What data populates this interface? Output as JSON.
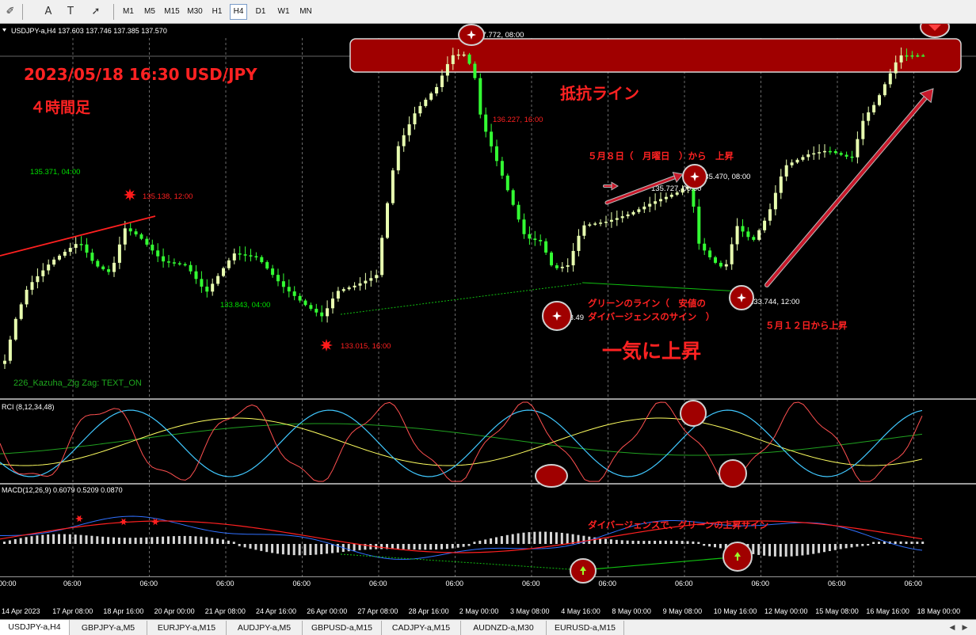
{
  "toolbar": {
    "icons": [
      "pen-tool-icon",
      "label-text-icon",
      "text-frame-icon",
      "arrows-icon"
    ],
    "icon_glyphs": [
      "✐",
      "A",
      "T",
      "➚"
    ],
    "timeframes": [
      "M1",
      "M5",
      "M15",
      "M30",
      "H1",
      "H4",
      "D1",
      "W1",
      "MN"
    ],
    "active_timeframe": "H4"
  },
  "chart": {
    "header": "USDJPY-a,H4  137.603 137.746 137.385 137.570",
    "price_labels": [
      {
        "text": "137.772, 08:00",
        "color": "#ffffff"
      },
      {
        "text": "136.227, 16:00",
        "color": "#ff2020"
      },
      {
        "text": "135.470, 08:00",
        "color": "#ffffff"
      },
      {
        "text": "135.727, 00:00",
        "color": "#ffffff"
      },
      {
        "text": "135.371, 04:00",
        "color": "#00e000"
      },
      {
        "text": "135.138, 12:00",
        "color": "#ff2020"
      },
      {
        "text": "133.843, 04:00",
        "color": "#00e000"
      },
      {
        "text": "133.015, 16:00",
        "color": "#ff2020"
      },
      {
        "text": "133.49",
        "color": "#ffffff"
      },
      {
        "text": "133.744, 12:00",
        "color": "#ffffff"
      }
    ],
    "indicator_label": "226_Kazuha_Zig Zag: TEXT_ON",
    "rci_label": "RCI (8,12,34,48)",
    "macd_label": "MACD(12,26,9) 0.6079 0.5209 0.0870",
    "x_axis_times": [
      "06:00",
      "06:00",
      "06:00",
      "06:00",
      "06:00",
      "06:00",
      "06:00",
      "06:00",
      "06:00",
      "06:00",
      "06:00",
      "06:00",
      "06:00"
    ],
    "x_axis_dates": [
      "14 Apr 2023",
      "17 Apr 08:00",
      "18 Apr 16:00",
      "20 Apr 00:00",
      "21 Apr 08:00",
      "24 Apr 16:00",
      "26 Apr 00:00",
      "27 Apr 08:00",
      "28 Apr 16:00",
      "2 May 00:00",
      "3 May 08:00",
      "4 May 16:00",
      "8 May 00:00",
      "9 May 08:00",
      "10 May 16:00",
      "12 May 00:00",
      "15 May 08:00",
      "16 May 16:00",
      "18 May 00:00"
    ]
  },
  "annotations": {
    "title": "2023/05/18 16:30  USD/JPY",
    "subtitle": "４時間足",
    "resistance": "抵抗ライン",
    "may8": "５月８日（　月曜日　）から　上昇",
    "green_line_1": "グリーンのライン（　安値の",
    "green_line_2": "ダイバージェンスのサイン　）",
    "may12": "５月１２日から上昇",
    "surge": "一気に上昇",
    "macd_note": "ダイバージェンスで、グリーンの上昇サイン"
  },
  "colors": {
    "bull_candle": "#e8ffb0",
    "bear_candle": "#33ff33",
    "annotation_red": "#ff2222",
    "resistance_fill": "#a00000",
    "rci_fast": "#ff5050",
    "rci_mid": "#40c8ff",
    "rci_slow": "#ffff60",
    "rci_long": "#20a020",
    "macd_line": "#3070ff",
    "signal_line": "#ff2020",
    "histogram": "#d8d8d8"
  },
  "tabs": [
    "USDJPY-a,H4",
    "GBPJPY-a,M5",
    "EURJPY-a,M15",
    "AUDJPY-a,M5",
    "GBPUSD-a,M15",
    "CADJPY-a,M15",
    "AUDNZD-a,M30",
    "EURUSD-a,M15"
  ],
  "active_tab": "USDJPY-a,H4"
}
